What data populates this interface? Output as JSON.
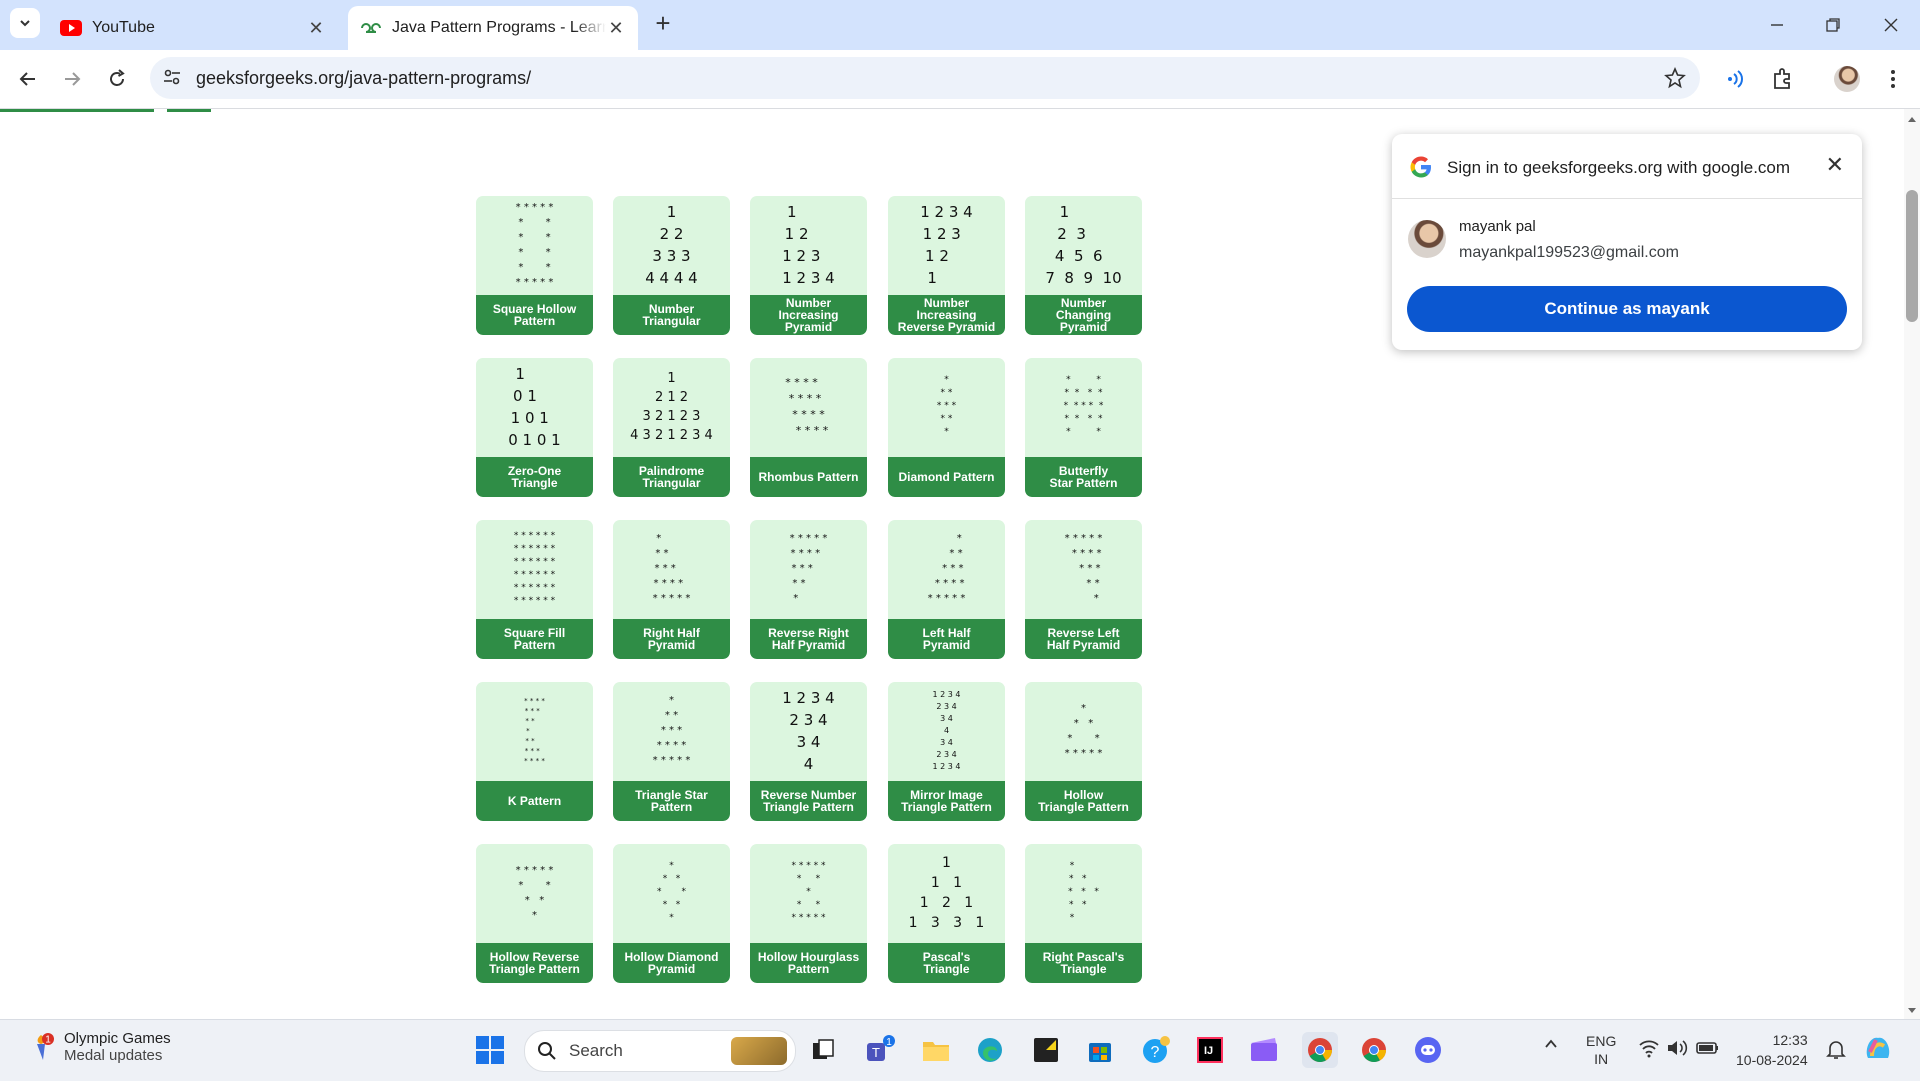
{
  "browser": {
    "tabs": [
      {
        "title": "YouTube",
        "favicon": "youtube-icon",
        "active": false
      },
      {
        "title": "Java Pattern Programs - Learn How to Print Pattern in Java",
        "favicon": "gfg-icon",
        "active": true
      }
    ],
    "url": "geeksforgeeks.org/java-pattern-programs/"
  },
  "patterns": [
    {
      "art": "* * * * *\n*       *\n*       *\n*       *\n*       *\n* * * * *",
      "label": "Square Hollow\nPattern",
      "size": 10
    },
    {
      "art": "1\n2 2\n3 3 3\n4 4 4 4",
      "label": "Number\nTriangular",
      "size": 15
    },
    {
      "art": "1       \n1 2     \n1 2 3   \n1 2 3 4",
      "label": "Number\nIncreasing\nPyramid",
      "size": 15
    },
    {
      "art": "1 2 3 4\n1 2 3  \n1 2    \n1      ",
      "label": "Number\nIncreasing\nReverse Pyramid",
      "size": 15
    },
    {
      "art": "1        \n2  3     \n4  5  6  \n7  8  9  10",
      "label": "Number\nChanging\nPyramid",
      "size": 15
    },
    {
      "art": "1      \n0 1    \n1 0 1  \n0 1 0 1",
      "label": "Zero-One\nTriangle",
      "size": 15
    },
    {
      "art": "1\n2 1 2\n3 2 1 2 3\n4 3 2 1 2 3 4",
      "label": "Palindrome\nTriangular",
      "size": 13
    },
    {
      "art": "* * * *    \n * * * *   \n  * * * *  \n   * * * * ",
      "label": "Rhombus Pattern",
      "size": 11
    },
    {
      "art": "*\n* *\n* * *\n* *\n*",
      "label": "Diamond Pattern",
      "size": 9
    },
    {
      "art": "*         *\n*  *   *  *\n*  * * *  *\n*  *   *  *\n*         *",
      "label": "Butterfly\nStar Pattern",
      "size": 9
    },
    {
      "art": "* * * * * *\n* * * * * *\n* * * * * *\n* * * * * *\n* * * * * *\n* * * * * *",
      "label": "Square Fill\nPattern",
      "size": 9
    },
    {
      "art": "*        \n* *      \n* * *    \n* * * *  \n* * * * *",
      "label": "Right Half\nPyramid",
      "size": 10
    },
    {
      "art": "* * * * *\n* * * *  \n* * *    \n* *      \n*        ",
      "label": "Reverse Right\nHalf Pyramid",
      "size": 10
    },
    {
      "art": "        *\n      * *\n    * * *\n  * * * *\n* * * * *",
      "label": "Left Half\nPyramid",
      "size": 10
    },
    {
      "art": "* * * * *\n  * * * *\n    * * *\n      * *\n        *",
      "label": "Reverse Left\nHalf Pyramid",
      "size": 10
    },
    {
      "art": "* * * *\n* * *  \n* *    \n*      \n* *    \n* * *  \n* * * *",
      "label": "K Pattern",
      "size": 7
    },
    {
      "art": "*\n* *\n* * *\n* * * *\n* * * * *",
      "label": "Triangle Star\nPattern",
      "size": 10
    },
    {
      "art": "1 2 3 4\n2 3 4\n3 4\n4",
      "label": "Reverse Number\nTriangle Pattern",
      "size": 15
    },
    {
      "art": "1 2 3 4\n2 3 4\n3 4\n4\n3 4\n2 3 4\n1 2 3 4",
      "label": "Mirror Image\nTriangle Pattern",
      "size": 8
    },
    {
      "art": "*\n*   *\n*       *\n* * * * *",
      "label": "Hollow\nTriangle Pattern",
      "size": 10
    },
    {
      "art": "* * * * *\n*       *\n*   *\n*",
      "label": "Hollow Reverse\nTriangle Pattern",
      "size": 10
    },
    {
      "art": "*\n*   *\n*       *\n*   *\n*",
      "label": "Hollow Diamond\nPyramid",
      "size": 9
    },
    {
      "art": "* * * * *\n*     *\n*\n*     *\n* * * * *",
      "label": "Hollow Hourglass\nPattern",
      "size": 9
    },
    {
      "art": "1\n1   1\n1   2   1\n1   3   3   1",
      "label": "Pascal's\nTriangle",
      "size": 14
    },
    {
      "art": "*        \n*   *    \n*   *   *\n*   *    \n*        ",
      "label": "Right Pascal's\nTriangle",
      "size": 9
    }
  ],
  "signin_popup": {
    "title": "Sign in to geeksforgeeks.org with google.com",
    "user_name": "mayank pal",
    "user_email": "mayankpal199523@gmail.com",
    "continue_label": "Continue as mayank"
  },
  "taskbar": {
    "weather_title": "Olympic Games",
    "weather_subtitle": "Medal updates",
    "weather_badge": "1",
    "search_placeholder": "Search",
    "teams_badge": "1",
    "lang_top": "ENG",
    "lang_bottom": "IN",
    "time": "12:33",
    "date": "10-08-2024"
  }
}
